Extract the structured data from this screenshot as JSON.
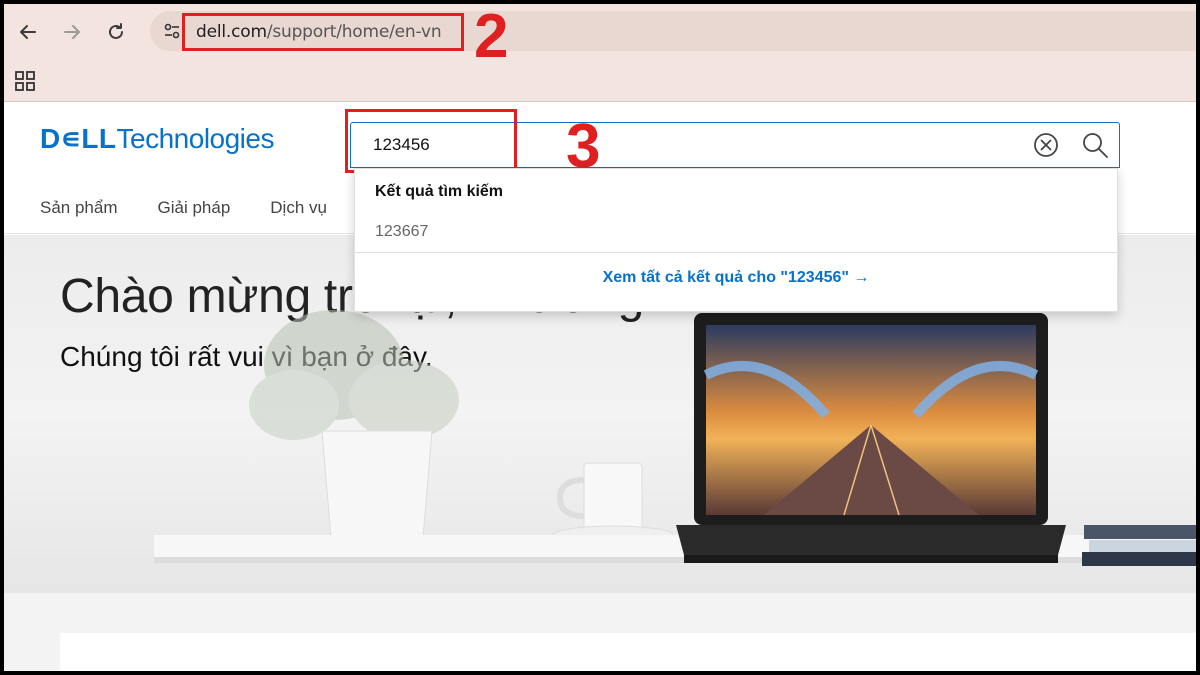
{
  "browser": {
    "url_domain": "dell.com",
    "url_path": "/support/home/en-vn",
    "back_icon": "arrow-left-icon",
    "forward_icon": "arrow-right-icon",
    "reload_icon": "reload-icon"
  },
  "header": {
    "logo_bold": "D∊LL",
    "logo_text": "Technologies",
    "search_value": "123456",
    "nav": [
      "Sản phẩm",
      "Giải pháp",
      "Dịch vụ"
    ]
  },
  "dropdown": {
    "heading": "Kết quả tìm kiếm",
    "result": "123667",
    "view_all": "Xem tất cả kết quả cho \"123456\" →"
  },
  "hero": {
    "title": "Chào mừng trở lại, Phương!",
    "subtitle": "Chúng tôi rất vui vì bạn ở đây."
  },
  "annotations": {
    "step_2": "2",
    "step_3": "3"
  },
  "colors": {
    "accent": "#0672cb",
    "annotation": "#e02020"
  }
}
